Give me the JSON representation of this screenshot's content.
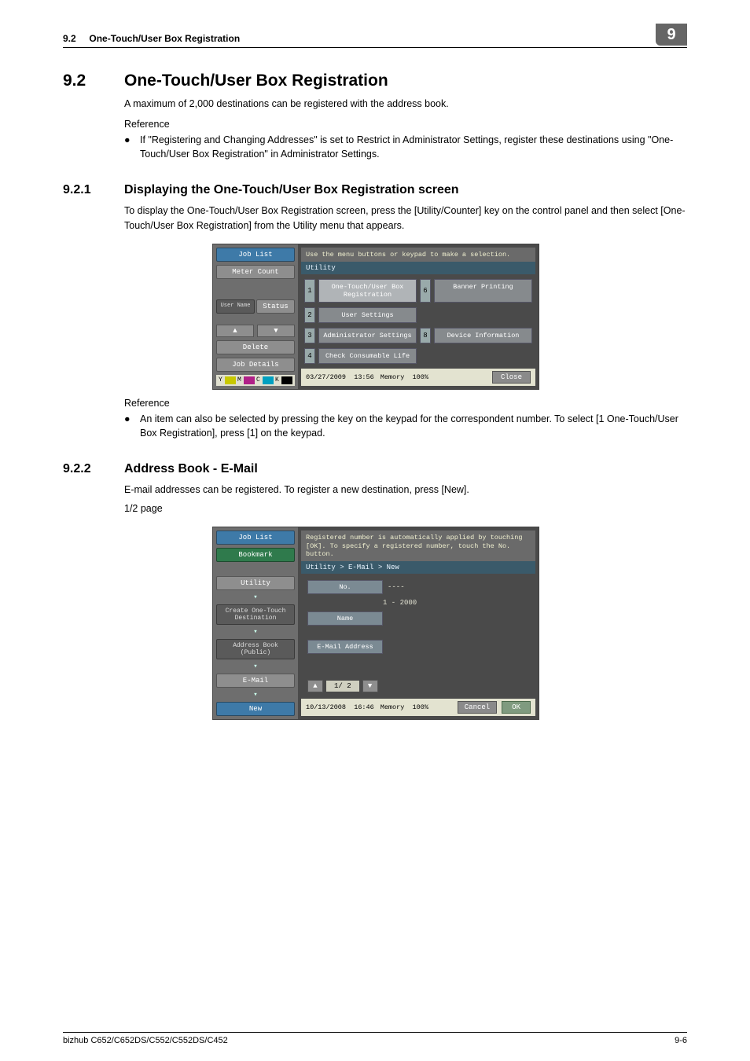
{
  "header": {
    "section_no": "9.2",
    "section_title": "One-Touch/User Box Registration",
    "chapter_no": "9"
  },
  "h92": {
    "num": "9.2",
    "title": "One-Touch/User Box Registration",
    "intro": "A maximum of 2,000 destinations can be registered with the address book.",
    "ref_label": "Reference",
    "bullet": "If \"Registering and Changing Addresses\" is set to Restrict in Administrator Settings, register these destinations using \"One-Touch/User Box Registration\" in Administrator Settings."
  },
  "h921": {
    "num": "9.2.1",
    "title": "Displaying the One-Touch/User Box Registration screen",
    "intro": "To display the One-Touch/User Box Registration screen, press the [Utility/Counter] key on the control panel and then select [One-Touch/User Box Registration] from the Utility menu that appears.",
    "ref_label": "Reference",
    "bullet": "An item can also be selected by pressing the key on the keypad for the correspondent number. To select [1 One-Touch/User Box Registration], press [1] on the keypad."
  },
  "h922": {
    "num": "9.2.2",
    "title": "Address Book - E-Mail",
    "intro": "E-mail addresses can be registered. To register a new destination, press [New].",
    "page_note": "1/2 page"
  },
  "panel1": {
    "topmsg": "Use the menu buttons or keypad to make a selection.",
    "breadcrumb": "Utility",
    "side": {
      "job_list": "Job List",
      "meter_count": "Meter Count",
      "user_name": "User Name",
      "status": "Status",
      "delete": "Delete",
      "job_details": "Job Details"
    },
    "menu": {
      "n1": "1",
      "b1": "One-Touch/User Box Registration",
      "n2": "2",
      "b2": "User Settings",
      "n3": "3",
      "b3": "Administrator Settings",
      "n4": "4",
      "b4": "Check Consumable Life",
      "n6": "6",
      "b6": "Banner Printing",
      "n8": "8",
      "b8": "Device Information"
    },
    "status": {
      "date": "03/27/2009",
      "time": "13:56",
      "mem": "Memory",
      "pct": "100%",
      "close": "Close"
    },
    "toner": {
      "y": "Y",
      "m": "M",
      "c": "C",
      "k": "K"
    }
  },
  "panel2": {
    "topmsg": "Registered number is automatically applied by touching [OK]. To specify a registered number, touch the No. button.",
    "breadcrumb": "Utility > E-Mail > New",
    "side": {
      "job_list": "Job List",
      "bookmark": "Bookmark",
      "utility": "Utility",
      "create": "Create One-Touch Destination",
      "addr_book": "Address Book (Public)",
      "email": "E-Mail",
      "new": "New"
    },
    "form": {
      "no_lbl": "No.",
      "no_val": "----",
      "range": "1 - 2000",
      "name_lbl": "Name",
      "email_lbl": "E-Mail Address"
    },
    "pagenav": {
      "ind": "1/ 2"
    },
    "status": {
      "date": "10/13/2008",
      "time": "16:46",
      "mem": "Memory",
      "pct": "100%",
      "cancel": "Cancel",
      "ok": "OK"
    }
  },
  "footer": {
    "model": "bizhub C652/C652DS/C552/C552DS/C452",
    "page": "9-6"
  }
}
